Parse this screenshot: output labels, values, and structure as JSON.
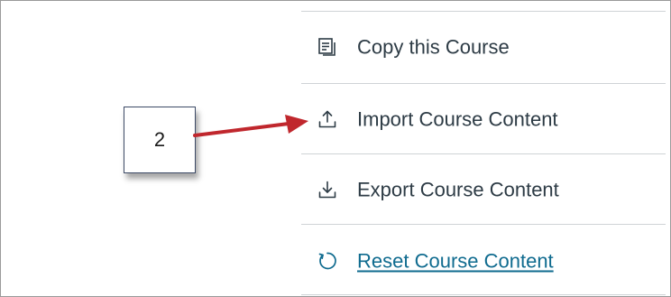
{
  "menu": {
    "items": [
      {
        "label": "Copy this Course",
        "icon": "copy-course-icon",
        "link": false
      },
      {
        "label": "Import Course Content",
        "icon": "upload-icon",
        "link": false
      },
      {
        "label": "Export Course Content",
        "icon": "download-icon",
        "link": false
      },
      {
        "label": "Reset Course Content",
        "icon": "reset-icon",
        "link": true
      }
    ]
  },
  "annotation": {
    "step_number": "2",
    "arrow_color": "#c0272d",
    "callout_border_color": "#3c4a66"
  },
  "colors": {
    "text": "#2d3b45",
    "link": "#0f6b8f",
    "divider": "#cfd3d6"
  }
}
